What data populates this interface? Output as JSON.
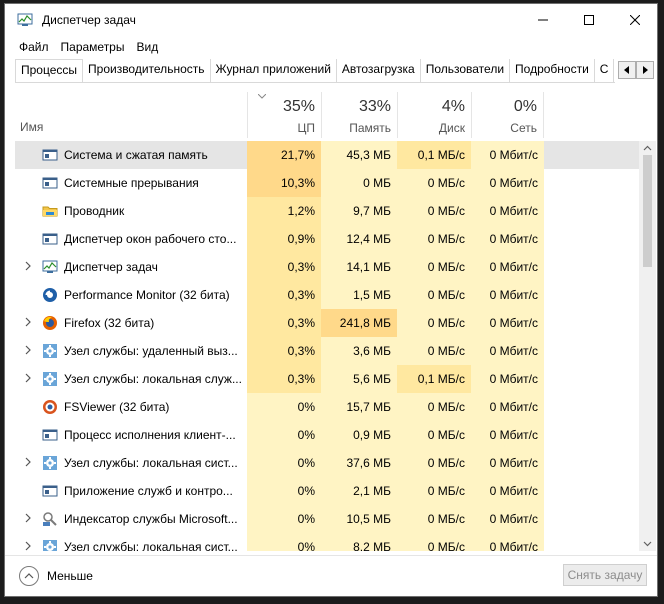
{
  "window": {
    "title": "Диспетчер задач",
    "controls": {
      "minimize_icon": "minimize-icon",
      "maximize_icon": "maximize-icon",
      "close_icon": "close-icon"
    }
  },
  "menu": [
    "Файл",
    "Параметры",
    "Вид"
  ],
  "tabs": [
    {
      "label": "Процессы",
      "active": true
    },
    {
      "label": "Производительность"
    },
    {
      "label": "Журнал приложений"
    },
    {
      "label": "Автозагрузка"
    },
    {
      "label": "Пользователи"
    },
    {
      "label": "Подробности"
    },
    {
      "label": "С"
    }
  ],
  "columns": {
    "name": "Имя",
    "cpu": {
      "pct": "35%",
      "label": "ЦП"
    },
    "memory": {
      "pct": "33%",
      "label": "Память"
    },
    "disk": {
      "pct": "4%",
      "label": "Диск"
    },
    "network": {
      "pct": "0%",
      "label": "Сеть"
    }
  },
  "colors": {
    "heat_low": "#fff4c4",
    "heat_mid": "#ffe8a0",
    "heat_high": "#ffd98a",
    "selected_row": "#e5e5e5"
  },
  "rows": [
    {
      "name": "Система и сжатая память",
      "cpu": "21,7%",
      "mem": "45,3 МБ",
      "disk": "0,1 МБ/с",
      "net": "0 Мбит/с",
      "expandable": false,
      "icon": "system-window-icon",
      "selected": true
    },
    {
      "name": "Системные прерывания",
      "cpu": "10,3%",
      "mem": "0 МБ",
      "disk": "0 МБ/с",
      "net": "0 Мбит/с",
      "expandable": false,
      "icon": "system-window-icon"
    },
    {
      "name": "Проводник",
      "cpu": "1,2%",
      "mem": "9,7 МБ",
      "disk": "0 МБ/с",
      "net": "0 Мбит/с",
      "expandable": false,
      "icon": "explorer-folder-icon"
    },
    {
      "name": "Диспетчер окон рабочего сто...",
      "cpu": "0,9%",
      "mem": "12,4 МБ",
      "disk": "0 МБ/с",
      "net": "0 Мбит/с",
      "expandable": false,
      "icon": "system-window-icon"
    },
    {
      "name": "Диспетчер задач",
      "cpu": "0,3%",
      "mem": "14,1 МБ",
      "disk": "0 МБ/с",
      "net": "0 Мбит/с",
      "expandable": true,
      "icon": "task-manager-icon"
    },
    {
      "name": "Performance Monitor (32 бита)",
      "cpu": "0,3%",
      "mem": "1,5 МБ",
      "disk": "0 МБ/с",
      "net": "0 Мбит/с",
      "expandable": false,
      "icon": "performance-monitor-icon"
    },
    {
      "name": "Firefox (32 бита)",
      "cpu": "0,3%",
      "mem": "241,8 МБ",
      "disk": "0 МБ/с",
      "net": "0 Мбит/с",
      "expandable": true,
      "icon": "firefox-icon"
    },
    {
      "name": "Узел службы: удаленный выз...",
      "cpu": "0,3%",
      "mem": "3,6 МБ",
      "disk": "0 МБ/с",
      "net": "0 Мбит/с",
      "expandable": true,
      "icon": "service-gear-icon"
    },
    {
      "name": "Узел службы: локальная служ...",
      "cpu": "0,3%",
      "mem": "5,6 МБ",
      "disk": "0,1 МБ/с",
      "net": "0 Мбит/с",
      "expandable": true,
      "icon": "service-gear-icon"
    },
    {
      "name": "FSViewer (32 бита)",
      "cpu": "0%",
      "mem": "15,7 МБ",
      "disk": "0 МБ/с",
      "net": "0 Мбит/с",
      "expandable": false,
      "icon": "fsviewer-icon"
    },
    {
      "name": "Процесс исполнения клиент-...",
      "cpu": "0%",
      "mem": "0,9 МБ",
      "disk": "0 МБ/с",
      "net": "0 Мбит/с",
      "expandable": false,
      "icon": "system-window-icon"
    },
    {
      "name": "Узел службы: локальная сист...",
      "cpu": "0%",
      "mem": "37,6 МБ",
      "disk": "0 МБ/с",
      "net": "0 Мбит/с",
      "expandable": true,
      "icon": "service-gear-icon"
    },
    {
      "name": "Приложение служб и контро...",
      "cpu": "0%",
      "mem": "2,1 МБ",
      "disk": "0 МБ/с",
      "net": "0 Мбит/с",
      "expandable": false,
      "icon": "system-window-icon"
    },
    {
      "name": "Индексатор службы Microsoft...",
      "cpu": "0%",
      "mem": "10,5 МБ",
      "disk": "0 МБ/с",
      "net": "0 Мбит/с",
      "expandable": true,
      "icon": "search-indexer-icon"
    },
    {
      "name": "Узел службы: локальная сист...",
      "cpu": "0%",
      "mem": "8,2 МБ",
      "disk": "0 МБ/с",
      "net": "0 Мбит/с",
      "expandable": true,
      "icon": "service-gear-icon"
    }
  ],
  "footer": {
    "fewer_details": "Меньше",
    "end_task": "Снять задачу"
  }
}
